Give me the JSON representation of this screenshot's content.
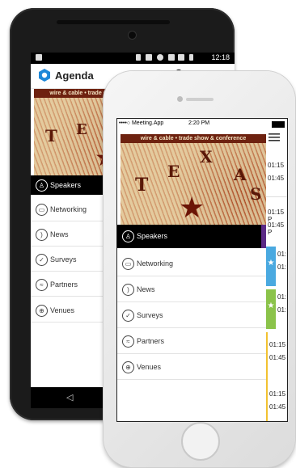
{
  "android": {
    "status_time": "12:18",
    "app_title": "Agenda",
    "banner": {
      "strip_text": "wire & cable • trade show & conference",
      "letters": [
        "T",
        "E",
        "X"
      ]
    },
    "menu": [
      {
        "label": "Speakers",
        "icon": "person-icon",
        "selected": true
      },
      {
        "label": "Networking",
        "icon": "chat-bubble-icon"
      },
      {
        "label": "News",
        "icon": "rss-icon"
      },
      {
        "label": "Surveys",
        "icon": "checkmark-icon"
      },
      {
        "label": "Partners",
        "icon": "handshake-icon"
      },
      {
        "label": "Venues",
        "icon": "globe-icon"
      }
    ]
  },
  "iphone": {
    "carrier": "••••○ Meeting.App",
    "status_time": "2:20 PM",
    "banner": {
      "strip_text": "wire & cable • trade show & conference",
      "letters": [
        "T",
        "E",
        "X",
        "A",
        "S"
      ]
    },
    "menu": [
      {
        "label": "Speakers",
        "icon": "person-icon",
        "selected": true
      },
      {
        "label": "Networking",
        "icon": "chat-bubble-icon"
      },
      {
        "label": "News",
        "icon": "rss-icon"
      },
      {
        "label": "Surveys",
        "icon": "checkmark-icon"
      },
      {
        "label": "Partners",
        "icon": "handshake-icon"
      },
      {
        "label": "Venues",
        "icon": "globe-icon"
      }
    ],
    "times": [
      "01:15",
      "01:45",
      "01:15 P",
      "01:45 P",
      "01:",
      "01:",
      "01:",
      "01:",
      "01:15",
      "01:45",
      "01:15",
      "01:45"
    ]
  },
  "colors": {
    "selected_bg": "#000000",
    "blue_tab": "#4aa9e0",
    "green_tab": "#8bc34a",
    "purple_accent": "#5b2a86",
    "yellow_line": "#f2c230"
  }
}
